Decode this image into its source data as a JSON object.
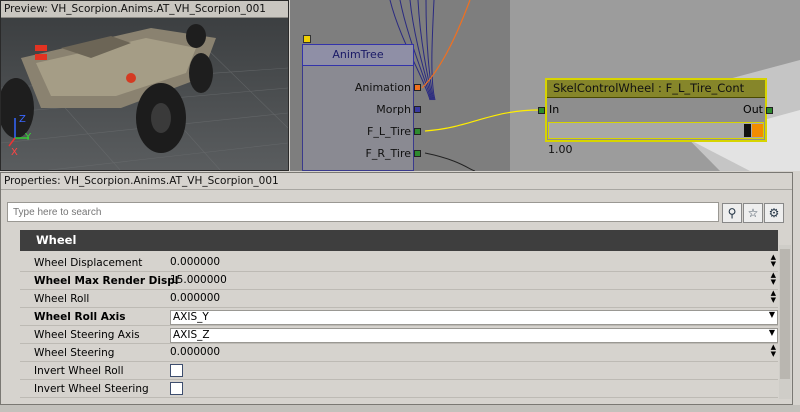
{
  "preview": {
    "title": "Preview: VH_Scorpion.Anims.AT_VH_Scorpion_001"
  },
  "animtree": {
    "node_title": "AnimTree",
    "pins": [
      "Animation",
      "Morph",
      "F_L_Tire",
      "F_R_Tire"
    ]
  },
  "skel": {
    "title": "SkelControlWheel : F_L_Tire_Cont",
    "in_label": "In",
    "out_label": "Out",
    "value": "1.00"
  },
  "properties": {
    "title": "Properties: VH_Scorpion.Anims.AT_VH_Scorpion_001",
    "search_placeholder": "Type here to search",
    "category": "Wheel",
    "rows": [
      {
        "label": "Wheel Displacement",
        "value": "0.000000",
        "bold": false
      },
      {
        "label": "Wheel Max Render Displ",
        "value": "15.000000",
        "bold": true
      },
      {
        "label": "Wheel Roll",
        "value": "0.000000",
        "bold": false
      },
      {
        "label": "Wheel Roll Axis",
        "value": "AXIS_Y",
        "bold": true
      },
      {
        "label": "Wheel Steering Axis",
        "value": "AXIS_Z",
        "bold": false
      },
      {
        "label": "Wheel Steering",
        "value": "0.000000",
        "bold": false
      },
      {
        "label": "Invert Wheel Roll",
        "value": "",
        "bold": false
      },
      {
        "label": "Invert Wheel Steering",
        "value": "",
        "bold": false
      }
    ]
  },
  "axis": {
    "z": "Z",
    "y": "Y",
    "x": "X"
  }
}
